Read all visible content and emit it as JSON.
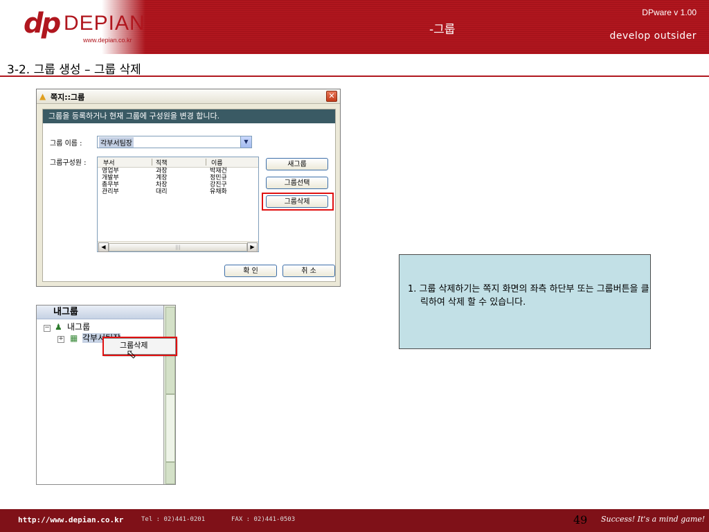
{
  "header": {
    "logo_mark": "dp",
    "logo_name": "DEPIAN",
    "logo_url": "www.depian.co.kr",
    "section": "-그룹",
    "version": "DPware v 1.00",
    "slogan": "develop outsider"
  },
  "page_title": "3-2. 그룹 생성 – 그룹 삭제",
  "dialog": {
    "title": "쪽지::그룹",
    "banner": "그룹을 등록하거나 현재 그룹에 구성원을 변경 합니다.",
    "group_name_label": "그룹 이름 :",
    "group_name_value": "각부서팀장",
    "members_label": "그룹구성원 :",
    "columns": [
      "부서",
      "직책",
      "이름"
    ],
    "rows": [
      [
        "영업부",
        "과장",
        "박재건"
      ],
      [
        "개발부",
        "계장",
        "정민규"
      ],
      [
        "총무부",
        "차장",
        "강진구"
      ],
      [
        "관리부",
        "대리",
        "유채화"
      ]
    ],
    "buttons": {
      "new_group": "새그룹",
      "select_group": "그룹선택",
      "delete_group": "그룹삭제",
      "ok": "확 인",
      "cancel": "취 소"
    }
  },
  "tree": {
    "header": "내그룹",
    "root": "내그룹",
    "child": "각부서팀장",
    "context_item": "그룹삭제"
  },
  "note": {
    "text": "1. 그룹 삭제하기는 쪽지 화면의 좌측 하단부 또는 그룹버튼을 클릭하여 삭제 할 수 있습니다."
  },
  "footer": {
    "url": "http://www.depian.co.kr",
    "tel": "Tel : 02)441-0201",
    "fax": "FAX : 02)441-0503",
    "page_number": "49",
    "motto": "Success! It's a mind game!"
  },
  "colors": {
    "brand_red": "#b0161e",
    "footer_red": "#7f1118",
    "banner": "#3a5a64",
    "note_bg": "#c2e0e6",
    "highlight": "#e01010"
  }
}
